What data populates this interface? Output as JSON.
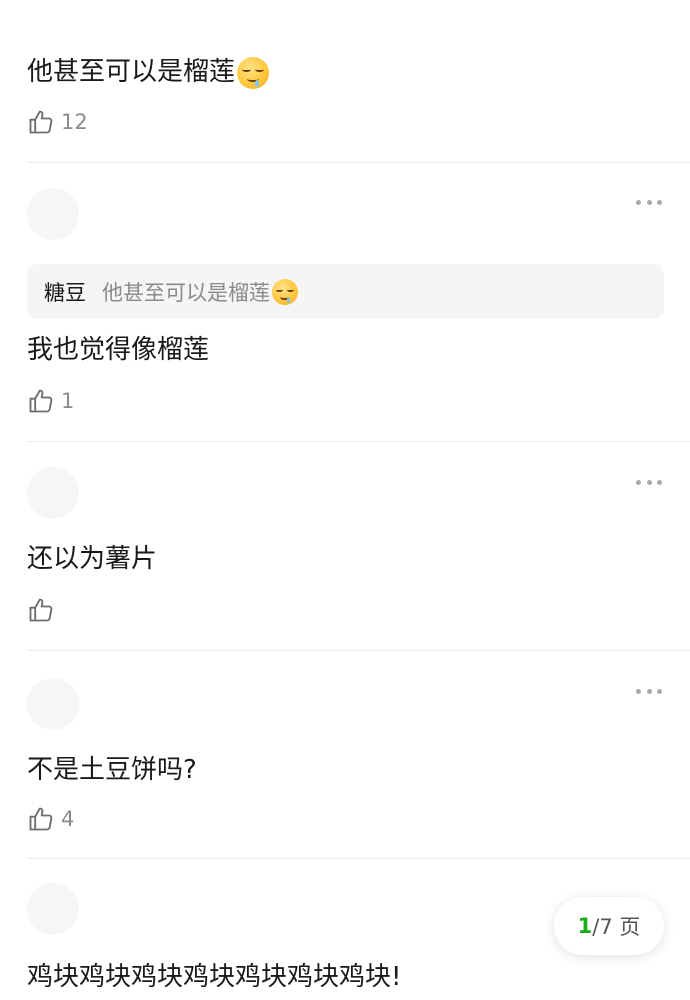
{
  "comments": [
    {
      "text": "他甚至可以是榴莲",
      "emoji": "drooling-face",
      "likes": "12"
    },
    {
      "quote": {
        "author": "糖豆",
        "text": "他甚至可以是榴莲",
        "emoji": "drooling-face"
      },
      "text": "我也觉得像榴莲",
      "likes": "1"
    },
    {
      "text": "还以为薯片",
      "likes": ""
    },
    {
      "text": "不是土豆饼吗?",
      "likes": "4"
    },
    {
      "text": "鸡块鸡块鸡块鸡块鸡块鸡块鸡块!"
    }
  ],
  "pager": {
    "current": "1",
    "rest": "/7 页"
  },
  "colors": {
    "accent": "#1aad19",
    "muted": "#8c8c8c",
    "quote_bg": "#f5f5f5"
  }
}
